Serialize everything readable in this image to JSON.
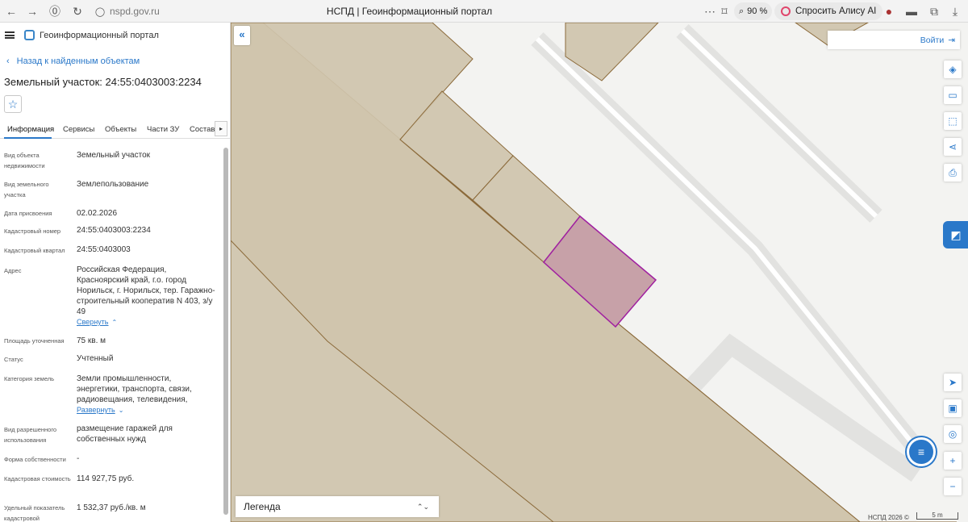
{
  "browser": {
    "url": "nspd.gov.ru",
    "tab_title": "НСПД | Геоинформационный портал",
    "zoom": "90 %",
    "alice": "Спросить Алису AI"
  },
  "panel": {
    "portal_title": "Геоинформационный портал",
    "back_link": "Назад к найденным объектам",
    "object_title": "Земельный участок: 24:55:0403003:2234",
    "tabs": [
      "Информация",
      "Сервисы",
      "Объекты",
      "Части ЗУ",
      "Состав"
    ],
    "rows": [
      {
        "label": "Вид объекта недвижимости",
        "value": "Земельный участок"
      },
      {
        "label": "Вид земельного участка",
        "value": "Землепользование"
      },
      {
        "label": "Дата присвоения",
        "value": "02.02.2026"
      },
      {
        "label": "Кадастровый номер",
        "value": "24:55:0403003:2234"
      },
      {
        "label": "Кадастровый квартал",
        "value": "24:55:0403003"
      },
      {
        "label": "Адрес",
        "value": "Российская Федерация, Красноярский край, г.о. город Норильск, г. Норильск, тер. Гаражно-строительный кооператив N 403, з/у 49"
      },
      {
        "label": "Площадь уточненная",
        "value": "75 кв. м"
      },
      {
        "label": "Статус",
        "value": "Учтенный"
      },
      {
        "label": "Категория земель",
        "value": "Земли промышленности, энергетики, транспорта, связи, радиовещания, телевидения,"
      },
      {
        "label": "Вид разрешенного использования",
        "value": "размещение гаражей для собственных нужд"
      },
      {
        "label": "Форма собственности",
        "value": "-"
      },
      {
        "label": "Кадастровая стоимость",
        "value": "114 927,75 руб."
      },
      {
        "label": "Удельный показатель кадастровой",
        "value": "1 532,37 руб./кв. м"
      }
    ],
    "collapse_link": "Свернуть",
    "expand_link": "Развернуть"
  },
  "map": {
    "login": "Войти",
    "legend": "Легенда",
    "copyright": "НСПД 2026 ©",
    "scale": "5 m",
    "colors": {
      "parcel_fill": "#cfc4ad",
      "parcel_border": "#8b6a3a",
      "selected_fill": "#c7a1a8",
      "selected_border": "#a020a0",
      "accent": "#2a78c9"
    }
  }
}
